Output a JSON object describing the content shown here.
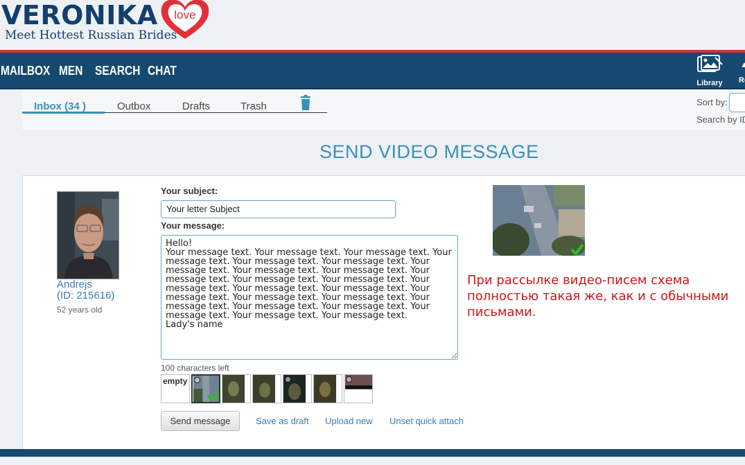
{
  "brand": {
    "name": "VERONIKA",
    "heart_text": "love",
    "tagline": "Meet Hottest Russian Brides",
    "primary_color": "#123f6e",
    "accent_color": "#c9363c",
    "heart_color": "#e0303a"
  },
  "nav": {
    "items": [
      {
        "label": "MAILBOX"
      },
      {
        "label": "MEN"
      },
      {
        "label": "SEARCH"
      },
      {
        "label": "CHAT"
      }
    ],
    "library_label": "Library",
    "library_icon": "library-image-icon",
    "extra_label": "Re",
    "background": "#16496f"
  },
  "mail_tabs": {
    "inbox": "Inbox (34 )",
    "outbox": "Outbox",
    "drafts": "Drafts",
    "trash": "Trash",
    "trash_icon": "trash-can-icon",
    "active_color": "#3b8fb8"
  },
  "sort": {
    "label": "Sort by:",
    "search_label": "Search by ID"
  },
  "page_title": "SEND VIDEO MESSAGE",
  "profile": {
    "name": "Andrejs",
    "id_text": "(ID: 215616)",
    "age_text": "52 years old"
  },
  "form": {
    "subject_label": "Your subject:",
    "subject_value": "Your letter Subject",
    "message_label": "Your message:",
    "message_value": "Hello!\nYour message text. Your message text. Your message text. Your message text. Your message text. Your message text. Your message text. Your message text. Your message text. Your message text. Your message text. Your message text. Your message text. Your message text. Your message text. Your message text. Your message text. Your message text. Your message text. Your message text. Your message text. Your message text. Your message text. Your message text.\nLady's name",
    "chars_left": "100 characters left"
  },
  "attachments": {
    "empty_label": "empty",
    "selected_index": 1
  },
  "actions": {
    "send": "Send message",
    "save_draft": "Save as draft",
    "upload_new": "Upload new",
    "unset_attach": "Unset quick attach"
  },
  "note": "При рассылке видео-писем схема полностью такая же, как и с обычными письмами."
}
